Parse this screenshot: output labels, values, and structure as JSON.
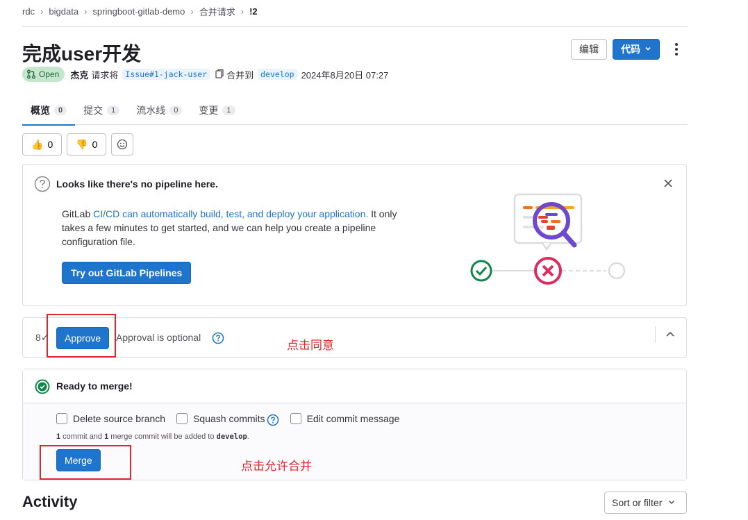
{
  "breadcrumb": [
    "rdc",
    "bigdata",
    "springboot-gitlab-demo",
    "合并请求",
    "!2"
  ],
  "title": "完成user开发",
  "header_buttons": {
    "edit": "编辑",
    "code": "代码"
  },
  "meta": {
    "status": "Open",
    "author": "杰克",
    "action": "请求将",
    "source_branch": "Issue#1-jack-user",
    "merge_into": "合并到",
    "target_branch": "develop",
    "date": "2024年8月20日 07:27"
  },
  "tabs": [
    {
      "label": "概览",
      "count": "0"
    },
    {
      "label": "提交",
      "count": "1"
    },
    {
      "label": "流水线",
      "count": "0"
    },
    {
      "label": "变更",
      "count": "1"
    }
  ],
  "reactions": {
    "thumbs_up": "0",
    "thumbs_down": "0"
  },
  "pipeline_card": {
    "title": "Looks like there's no pipeline here.",
    "body_prefix": "GitLab ",
    "body_link": "CI/CD can automatically build, test, and deploy your application.",
    "body_suffix": " It only takes a few minutes to get started, and we can help you create a pipeline configuration file.",
    "button": "Try out GitLab Pipelines"
  },
  "approval": {
    "icon_text": "8✓",
    "button": "Approve",
    "text": "Approval is optional"
  },
  "merge": {
    "title": "Ready to merge!",
    "options": [
      "Delete source branch",
      "Squash commits",
      "Edit commit message"
    ],
    "note_commit_count": "1",
    "note_part1": " commit and ",
    "note_merge_count": "1",
    "note_part2": " merge commit will be added to ",
    "note_branch": "develop",
    "note_end": ".",
    "button": "Merge"
  },
  "activity": {
    "title": "Activity",
    "sort": "Sort or filter"
  },
  "annotations": {
    "approve_note": "点击同意",
    "merge_note": "点击允许合并"
  },
  "colors": {
    "primary": "#1f75cb",
    "annotation": "#e0262b",
    "success": "#108548"
  }
}
